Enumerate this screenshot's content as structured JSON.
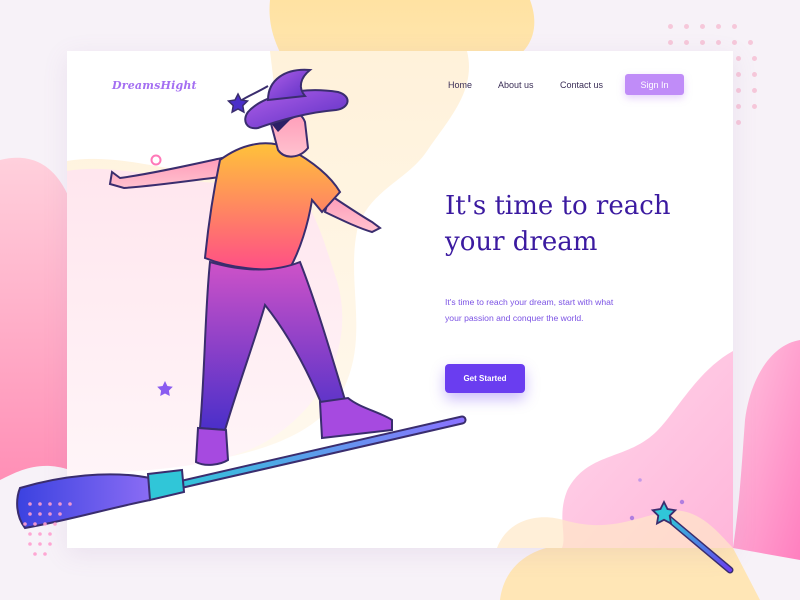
{
  "brand": {
    "logo": "DreamsHight"
  },
  "nav": {
    "items": [
      "Home",
      "About us",
      "Contact us"
    ],
    "signin_label": "Sign In"
  },
  "hero": {
    "headline_line1": "It's time to reach",
    "headline_line2": "your dream",
    "subtext_line1": "It's time to reach your dream, start with what",
    "subtext_line2": "your passion and conquer the world.",
    "cta_label": "Get Started"
  },
  "colors": {
    "accent": "#6a3df0",
    "headline": "#3b1aa0",
    "signin": "#c08cf8",
    "logo": "#a46ff2",
    "blob_yellow": "#ffe3a8",
    "blob_pink": "#ff9fc0"
  },
  "icons": [
    "star-icon",
    "magic-wand-icon",
    "broom-icon"
  ]
}
